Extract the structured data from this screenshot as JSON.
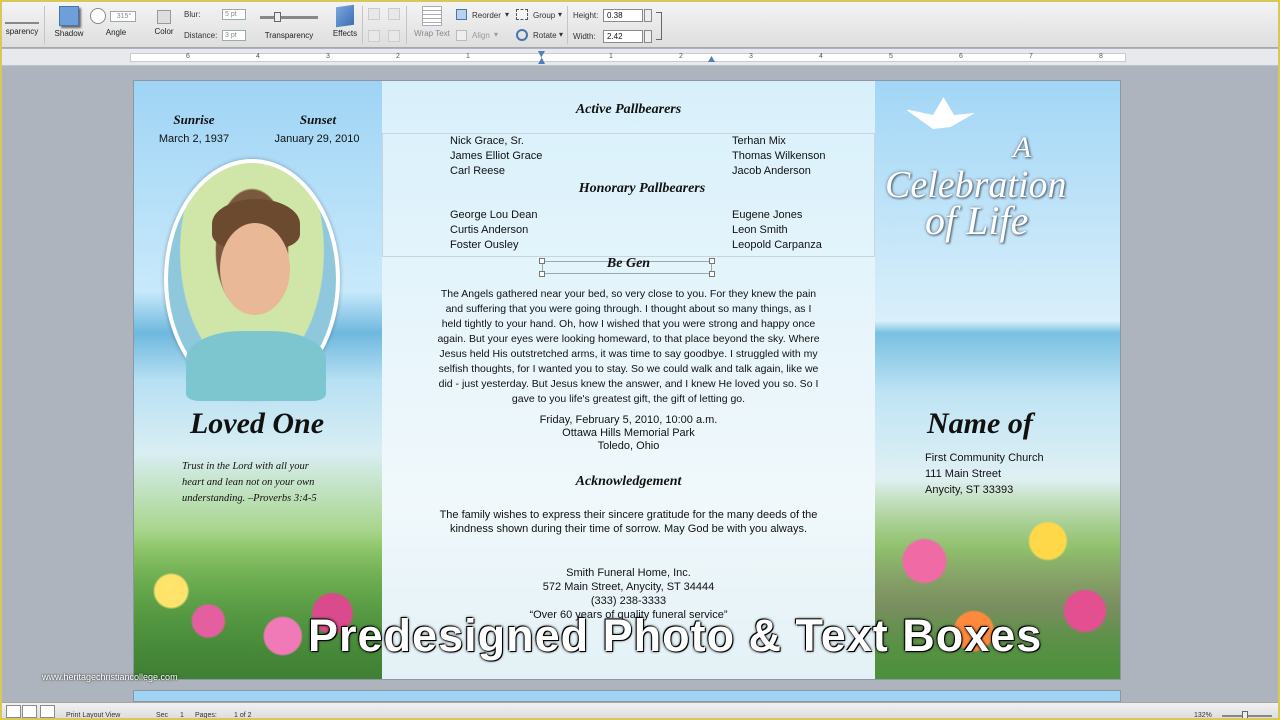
{
  "ribbon": {
    "transparency_left": "sparency",
    "shadow": "Shadow",
    "angle": "Angle",
    "angle_value": "315°",
    "color": "Color",
    "blur_label": "Blur:",
    "blur_value": "5 pt",
    "distance_label": "Distance:",
    "distance_value": "3 pt",
    "transparency": "Transparency",
    "effects": "Effects",
    "wrap_text": "Wrap Text",
    "reorder": "Reorder",
    "align": "Align",
    "group": "Group",
    "rotate": "Rotate",
    "height_label": "Height:",
    "height_value": "0.38",
    "width_label": "Width:",
    "width_value": "2.42"
  },
  "ruler": {
    "ticks": [
      "6",
      "4",
      "3",
      "2",
      "1",
      "1",
      "2",
      "3",
      "4",
      "5",
      "6",
      "7",
      "8"
    ]
  },
  "left_panel": {
    "sunrise_label": "Sunrise",
    "sunrise_date": "March 2, 1937",
    "sunset_label": "Sunset",
    "sunset_date": "January 29, 2010",
    "name": "Loved One",
    "verse": [
      "Trust in the Lord with all your",
      "heart and lean not on your own",
      "understanding. –Proverbs 3:4-5"
    ]
  },
  "middle_panel": {
    "active_title": "Active Pallbearers",
    "active_left": [
      "Nick Grace, Sr.",
      "James Elliot Grace",
      "Carl Reese"
    ],
    "active_right": [
      "Terhan Mix",
      "Thomas Wilkenson",
      "Jacob Anderson"
    ],
    "honorary_title": "Honorary Pallbearers",
    "honorary_left": [
      "George Lou Dean",
      "Curtis Anderson",
      "Foster Ousley"
    ],
    "honorary_right": [
      "Eugene Jones",
      "Leon Smith",
      "Leopold Carpanza"
    ],
    "poem_title": "Be Gen",
    "poem": [
      "The Angels gathered near your bed, so very close to you. For they knew the pain",
      "and suffering that you were going through. I thought about so many things, as I",
      "held tightly to your hand. Oh, how I wished that you were strong and happy once",
      "again. But your eyes were looking homeward, to that place beyond the sky. Where",
      "Jesus held His outstretched arms, it was time to say goodbye. I struggled with my",
      "selfish thoughts, for I wanted you to stay. So we could walk and talk again, like we",
      "did - just yesterday. But Jesus knew the answer, and I knew He loved you so. So I",
      "gave to you life's greatest gift, the gift of letting go."
    ],
    "service_date": "Friday, February 5, 2010, 10:00 a.m.",
    "service_place": "Ottawa Hills Memorial Park",
    "service_city": "Toledo, Ohio",
    "ack_title": "Acknowledgement",
    "ack_text": [
      "The family wishes to express their sincere gratitude for the many deeds of the",
      "kindness shown during their time of sorrow. May God be with you always."
    ],
    "funeral_home": "Smith Funeral Home, Inc.",
    "funeral_address": "572 Main Street, Anycity, ST 34444",
    "funeral_phone": "(333) 238-3333",
    "funeral_tagline": "“Over 60 years of quality funeral service”"
  },
  "right_panel": {
    "celebration": [
      "A",
      "Celebration",
      "of Life"
    ],
    "name": "Name of",
    "church": "First Community Church",
    "street": "111 Main Street",
    "city": "Anycity, ST 33393"
  },
  "overlay_caption": "Predesigned Photo & Text Boxes",
  "watermark": "www.heritagechristiancollege.com",
  "status": {
    "view": "Print Layout View",
    "sec_label": "Sec",
    "sec_value": "1",
    "pages_label": "Pages:",
    "pages_value": "1 of 2",
    "zoom": "132%"
  }
}
